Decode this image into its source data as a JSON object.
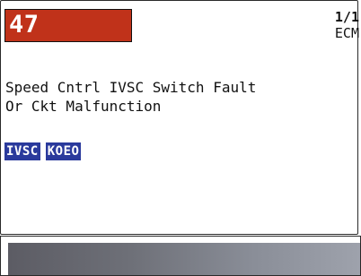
{
  "screen": {
    "dtc_code": "47",
    "code_count": "1/1",
    "module": "ECM",
    "description_line1": "Speed Cntrl IVSC Switch Fault",
    "description_line2": "Or Ckt Malfunction",
    "tags": [
      "IVSC",
      "KOEO"
    ]
  },
  "colors": {
    "code_box": "#c0321a",
    "tag_background": "#2a3a9c",
    "bottom_bar_gradient_start": "#5c5c64",
    "bottom_bar_gradient_end": "#9ea2ac"
  }
}
